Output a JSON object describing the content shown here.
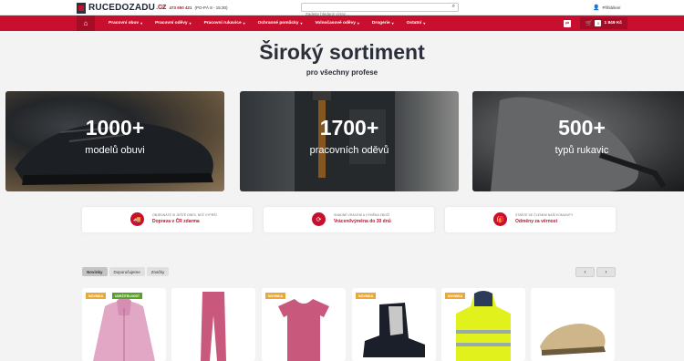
{
  "header": {
    "logo_text": "RUCEDOZADU",
    "logo_tld": ".CZ",
    "phone": "473 650 421",
    "phone_hours": "(PO-PÁ 8 - 15:30)",
    "search_placeholder": "Zadejte hledaný výraz…",
    "login_label": "Přihlášení"
  },
  "nav": {
    "items": [
      {
        "label": "Pracovní obuv"
      },
      {
        "label": "Pracovní oděvy"
      },
      {
        "label": "Pracovní rukavice"
      },
      {
        "label": "Ochranné pomůcky"
      },
      {
        "label": "Volnočasové oděvy"
      },
      {
        "label": "Drogerie"
      },
      {
        "label": "Ostatní"
      }
    ],
    "cart_count": "0",
    "cart_total": "1 849 Kč"
  },
  "hero": {
    "title": "Široký sortiment",
    "subtitle": "pro všechny profese"
  },
  "tiles": [
    {
      "number": "1000+",
      "label": "modelů obuvi"
    },
    {
      "number": "1700+",
      "label": "pracovních oděvů"
    },
    {
      "number": "500+",
      "label": "typů rukavic"
    }
  ],
  "benefits": [
    {
      "small": "Objednáte si ještě dnes, než vyprší",
      "big": "Doprava v ČR zdarma",
      "icon": "truck-icon"
    },
    {
      "small": "Snadné vrácení a výměna zboží",
      "big": "Vrácení/výměna do 30 dnů",
      "icon": "refresh-icon"
    },
    {
      "small": "Staňte se členem naší komunity",
      "big": "Odměny za věrnost",
      "icon": "gift-icon"
    }
  ],
  "products": {
    "tabs": [
      {
        "label": "Novinky"
      },
      {
        "label": "Doporučujeme"
      },
      {
        "label": "Značky"
      }
    ],
    "badge_new": "NOVINKA",
    "badge_eco": "UDRŽITELNOST",
    "colors": {
      "accent": "#c8102e",
      "badge_new": "#e8a93a",
      "badge_eco": "#5aa02c"
    }
  }
}
